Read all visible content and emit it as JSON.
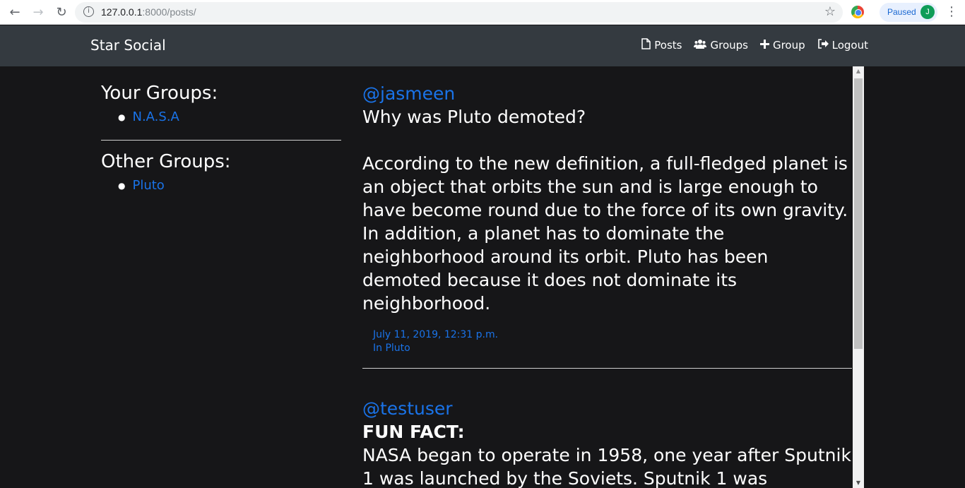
{
  "browser": {
    "url_host": "127.0.0.1",
    "url_path": ":8000/posts/",
    "profile_status": "Paused",
    "profile_initial": "J"
  },
  "navbar": {
    "brand": "Star Social",
    "links": [
      {
        "icon": "file-icon",
        "label": "Posts"
      },
      {
        "icon": "users-icon",
        "label": "Groups"
      },
      {
        "icon": "plus-icon",
        "label": "Group"
      },
      {
        "icon": "logout-icon",
        "label": "Logout"
      }
    ]
  },
  "sidebar": {
    "your_groups_heading": "Your Groups:",
    "your_groups": [
      "N.A.S.A"
    ],
    "other_groups_heading": "Other Groups:",
    "other_groups": [
      "Pluto"
    ]
  },
  "posts": [
    {
      "user": "@jasmeen",
      "title": "Why was Pluto demoted?",
      "body": "According to the new definition, a full-fledged planet is an object that orbits the sun and is large enough to have become round due to the force of its own gravity. In addition, a planet has to dominate the neighborhood around its orbit. Pluto has been demoted because it does not dominate its neighborhood.",
      "date": "July 11, 2019, 12:31 p.m.",
      "group": "In Pluto"
    },
    {
      "user": "@testuser",
      "title": "FUN FACT:",
      "body": "NASA began to operate in 1958, one year after Sputnik 1 was launched by the Soviets. Sputnik 1 was"
    }
  ]
}
